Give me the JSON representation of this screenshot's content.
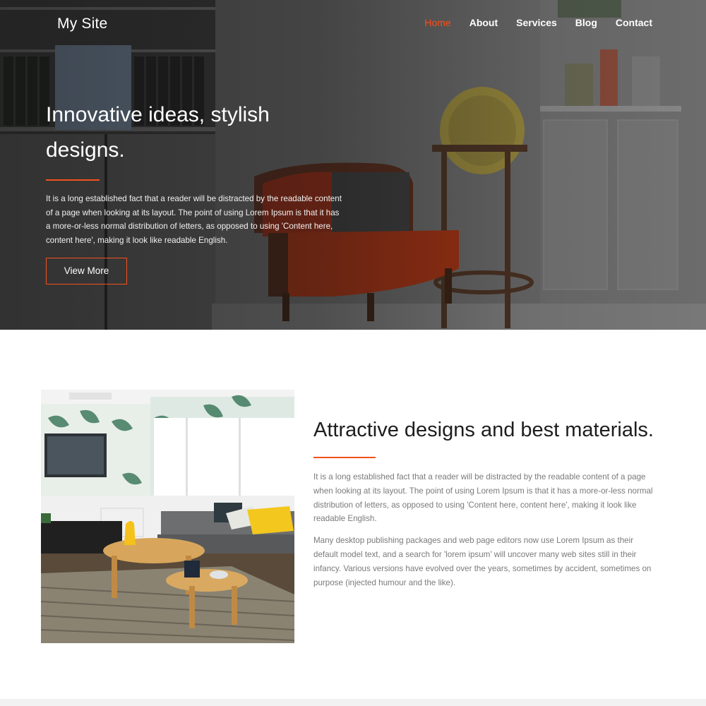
{
  "nav": {
    "brand": "My Site",
    "links": [
      {
        "label": "Home",
        "active": true
      },
      {
        "label": "About",
        "active": false
      },
      {
        "label": "Services",
        "active": false
      },
      {
        "label": "Blog",
        "active": false
      },
      {
        "label": "Contact",
        "active": false
      }
    ]
  },
  "hero": {
    "title": "Innovative ideas, stylish designs.",
    "text": "It is a long established fact that a reader will be distracted by the readable content of a page when looking at its layout. The point of using Lorem Ipsum is that it has a more-or-less normal distribution of letters, as opposed to using 'Content here, content here', making it look like readable English.",
    "button_label": "View More",
    "image_alt": "living-room-with-armchair-and-globe"
  },
  "feature": {
    "title": "Attractive designs and best materials.",
    "paragraphs": [
      "It is a long established fact that a reader will be distracted by the readable content of a page when looking at its layout. The point of using Lorem Ipsum is that it has a more-or-less normal distribution of letters, as opposed to using 'Content here, content here', making it look like readable English.",
      "Many desktop publishing packages and web page editors now use Lorem Ipsum as their default model text, and a search for 'lorem ipsum' will uncover many web sites still in their infancy. Various versions have evolved over the years, sometimes by accident, sometimes on purpose (injected humour and the like)."
    ],
    "image_alt": "living-room-with-sofa-and-coffee-table"
  },
  "colors": {
    "accent": "#f4511e",
    "heading_dark": "#1e1e1e",
    "body_gray": "#7a7a7a"
  }
}
